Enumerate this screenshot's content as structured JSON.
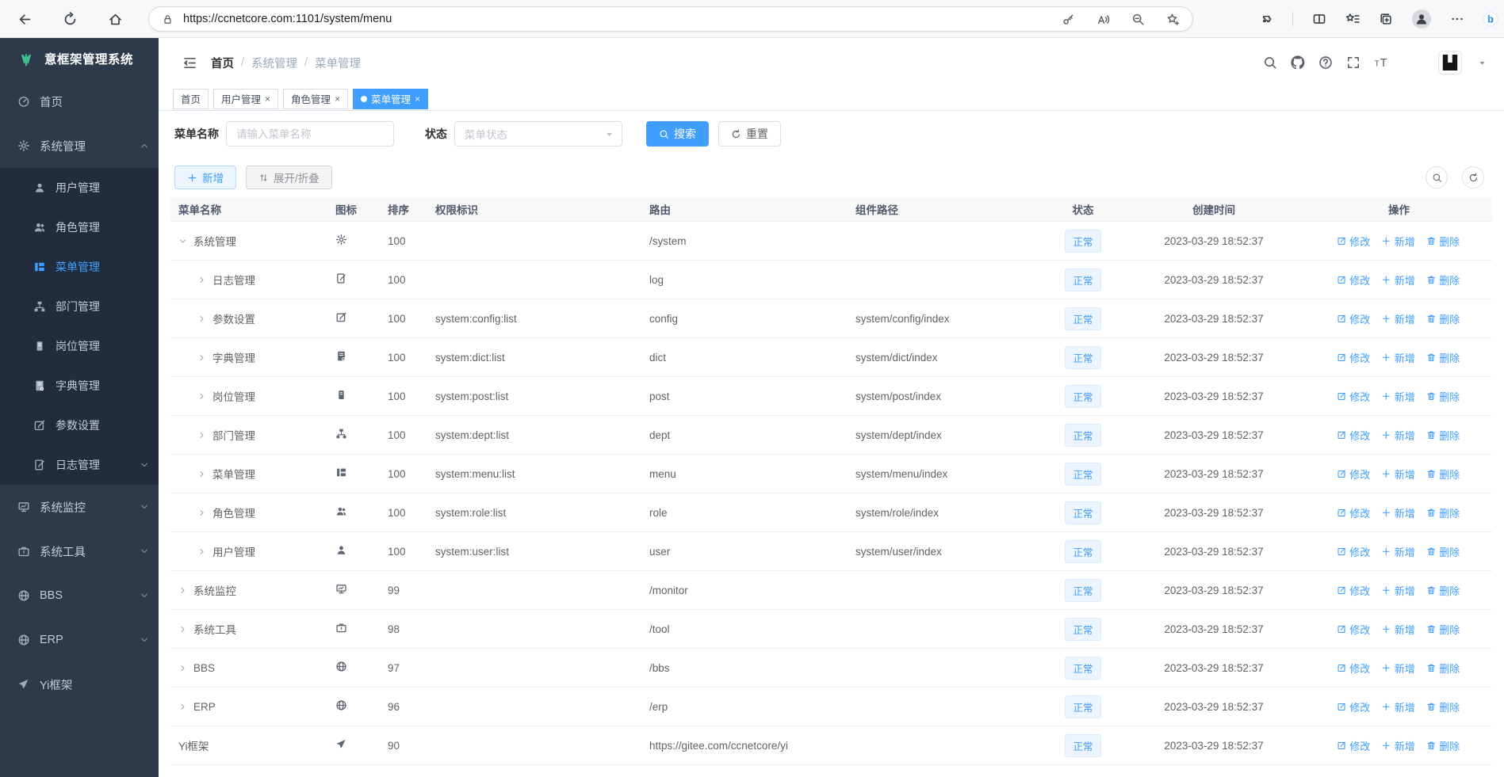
{
  "colors": {
    "accent": "#409eff",
    "link": "#409eff",
    "sidebar_bg": "#2d3a4b",
    "submenu_bg": "#212c3e",
    "sidebar_text": "#c3cbd6",
    "tab_active_bg": "#409eff",
    "status_tag_bg": "#ecf5ff",
    "status_tag_border": "#d9ecff"
  },
  "browser": {
    "url": "https://ccnetcore.com:1101/system/menu",
    "nav_icons": [
      "back",
      "reload",
      "home"
    ],
    "pill_lock_icon": "lock",
    "pill_right_icons": [
      "key",
      "read-aloud",
      "zoom-out",
      "star-plus"
    ],
    "right_icons": [
      "extensions",
      "split-screen",
      "favorites",
      "collections",
      "profile",
      "more"
    ],
    "assistant_icon": "bing"
  },
  "sidebar": {
    "logo_icon": "plant",
    "title": "意框架管理系统",
    "items": [
      {
        "key": "home",
        "label": "首页",
        "icon": "dashboard",
        "level": 0
      },
      {
        "key": "system-management",
        "label": "系统管理",
        "icon": "gear",
        "level": 0,
        "chevron": "up"
      },
      {
        "key": "user-management",
        "label": "用户管理",
        "icon": "user",
        "level": 1
      },
      {
        "key": "role-management",
        "label": "角色管理",
        "icon": "users",
        "level": 1
      },
      {
        "key": "menu-management",
        "label": "菜单管理",
        "icon": "menu-tree",
        "level": 1,
        "active": true
      },
      {
        "key": "dept-management",
        "label": "部门管理",
        "icon": "dept-tree",
        "level": 1
      },
      {
        "key": "post-management",
        "label": "岗位管理",
        "icon": "badge",
        "level": 1
      },
      {
        "key": "dict-management",
        "label": "字典管理",
        "icon": "book",
        "level": 1
      },
      {
        "key": "param-settings",
        "label": "参数设置",
        "icon": "edit-square",
        "level": 1
      },
      {
        "key": "log-management",
        "label": "日志管理",
        "icon": "log-doc",
        "level": 1,
        "chevron": "down"
      },
      {
        "key": "system-monitor",
        "label": "系统监控",
        "icon": "monitor",
        "level": 0,
        "chevron": "down"
      },
      {
        "key": "system-tools",
        "label": "系统工具",
        "icon": "toolbox",
        "level": 0,
        "chevron": "down"
      },
      {
        "key": "bbs",
        "label": "BBS",
        "icon": "globe",
        "level": 0,
        "chevron": "down"
      },
      {
        "key": "erp",
        "label": "ERP",
        "icon": "globe",
        "level": 0,
        "chevron": "down"
      },
      {
        "key": "yi-framework",
        "label": "Yi框架",
        "icon": "plane",
        "level": 0
      }
    ]
  },
  "header": {
    "collapse_icon": "hamburger",
    "breadcrumb": [
      "首页",
      "系统管理",
      "菜单管理"
    ],
    "separator": "/",
    "right_icons": [
      "search",
      "github",
      "question",
      "fullscreen",
      "font-size"
    ],
    "user_logo_icon": "y-logo",
    "user_caret_icon": "caret-down"
  },
  "tabs": [
    {
      "label": "首页",
      "closable": false,
      "active": false
    },
    {
      "label": "用户管理",
      "closable": true,
      "active": false
    },
    {
      "label": "角色管理",
      "closable": true,
      "active": false
    },
    {
      "label": "菜单管理",
      "closable": true,
      "active": true
    }
  ],
  "filters": {
    "name_label": "菜单名称",
    "name_placeholder": "请输入菜单名称",
    "name_value": "",
    "status_label": "状态",
    "status_placeholder": "菜单状态",
    "status_caret_icon": "caret-down",
    "search_button": "搜索",
    "search_icon": "search",
    "reset_button": "重置",
    "reset_icon": "refresh"
  },
  "toolbar": {
    "add_button": "新增",
    "add_icon": "plus",
    "toggle_button": "展开/折叠",
    "toggle_icon": "sort-arrows",
    "mini_buttons": [
      "search",
      "refresh"
    ]
  },
  "table": {
    "columns": [
      "菜单名称",
      "图标",
      "排序",
      "权限标识",
      "路由",
      "组件路径",
      "状态",
      "创建时间",
      "操作"
    ],
    "actions": [
      {
        "label": "修改",
        "icon": "edit-pen"
      },
      {
        "label": "新增",
        "icon": "plus"
      },
      {
        "label": "删除",
        "icon": "trash"
      }
    ],
    "rows": [
      {
        "name": "系统管理",
        "icon": "gear",
        "arrow": "down",
        "level": 0,
        "order": "100",
        "perm": "",
        "route": "/system",
        "component": "",
        "status": "正常",
        "created": "2023-03-29 18:52:37"
      },
      {
        "name": "日志管理",
        "icon": "log-doc",
        "arrow": "right",
        "level": 1,
        "order": "100",
        "perm": "",
        "route": "log",
        "component": "",
        "status": "正常",
        "created": "2023-03-29 18:52:37"
      },
      {
        "name": "参数设置",
        "icon": "edit-square",
        "arrow": "right",
        "level": 1,
        "order": "100",
        "perm": "system:config:list",
        "route": "config",
        "component": "system/config/index",
        "status": "正常",
        "created": "2023-03-29 18:52:37"
      },
      {
        "name": "字典管理",
        "icon": "book",
        "arrow": "right",
        "level": 1,
        "order": "100",
        "perm": "system:dict:list",
        "route": "dict",
        "component": "system/dict/index",
        "status": "正常",
        "created": "2023-03-29 18:52:37"
      },
      {
        "name": "岗位管理",
        "icon": "badge",
        "arrow": "right",
        "level": 1,
        "order": "100",
        "perm": "system:post:list",
        "route": "post",
        "component": "system/post/index",
        "status": "正常",
        "created": "2023-03-29 18:52:37"
      },
      {
        "name": "部门管理",
        "icon": "dept-tree",
        "arrow": "right",
        "level": 1,
        "order": "100",
        "perm": "system:dept:list",
        "route": "dept",
        "component": "system/dept/index",
        "status": "正常",
        "created": "2023-03-29 18:52:37"
      },
      {
        "name": "菜单管理",
        "icon": "menu-tree",
        "arrow": "right",
        "level": 1,
        "order": "100",
        "perm": "system:menu:list",
        "route": "menu",
        "component": "system/menu/index",
        "status": "正常",
        "created": "2023-03-29 18:52:37"
      },
      {
        "name": "角色管理",
        "icon": "users",
        "arrow": "right",
        "level": 1,
        "order": "100",
        "perm": "system:role:list",
        "route": "role",
        "component": "system/role/index",
        "status": "正常",
        "created": "2023-03-29 18:52:37"
      },
      {
        "name": "用户管理",
        "icon": "user",
        "arrow": "right",
        "level": 1,
        "order": "100",
        "perm": "system:user:list",
        "route": "user",
        "component": "system/user/index",
        "status": "正常",
        "created": "2023-03-29 18:52:37"
      },
      {
        "name": "系统监控",
        "icon": "monitor",
        "arrow": "right",
        "level": 0,
        "order": "99",
        "perm": "",
        "route": "/monitor",
        "component": "",
        "status": "正常",
        "created": "2023-03-29 18:52:37"
      },
      {
        "name": "系统工具",
        "icon": "toolbox",
        "arrow": "right",
        "level": 0,
        "order": "98",
        "perm": "",
        "route": "/tool",
        "component": "",
        "status": "正常",
        "created": "2023-03-29 18:52:37"
      },
      {
        "name": "BBS",
        "icon": "globe",
        "arrow": "right",
        "level": 0,
        "order": "97",
        "perm": "",
        "route": "/bbs",
        "component": "",
        "status": "正常",
        "created": "2023-03-29 18:52:37"
      },
      {
        "name": "ERP",
        "icon": "globe",
        "arrow": "right",
        "level": 0,
        "order": "96",
        "perm": "",
        "route": "/erp",
        "component": "",
        "status": "正常",
        "created": "2023-03-29 18:52:37"
      },
      {
        "name": "Yi框架",
        "icon": "plane",
        "arrow": "none",
        "level": 0,
        "order": "90",
        "perm": "",
        "route": "https://gitee.com/ccnetcore/yi",
        "component": "",
        "status": "正常",
        "created": "2023-03-29 18:52:37"
      }
    ]
  }
}
